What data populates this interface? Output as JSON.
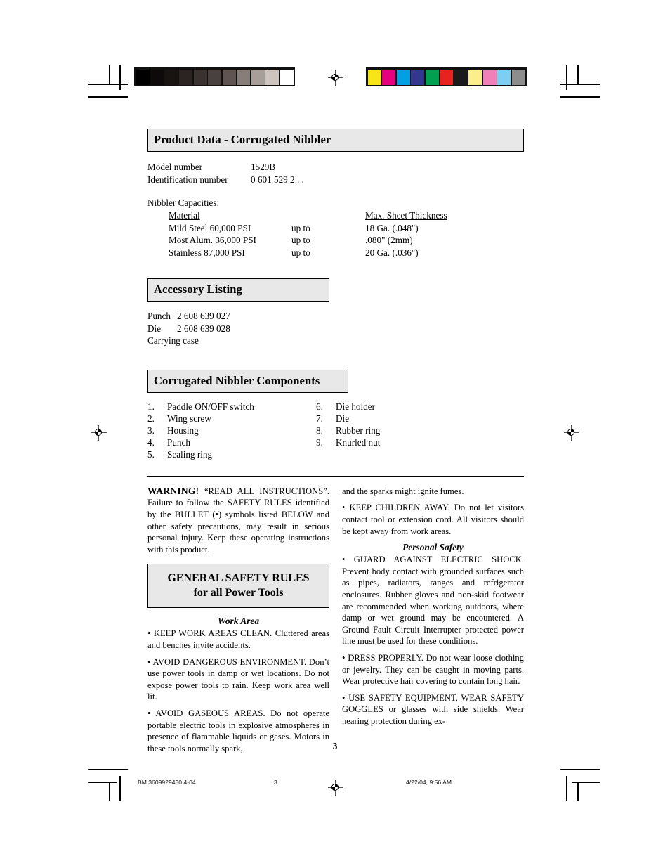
{
  "document": {
    "page_number": "3"
  },
  "print_marks": {
    "grayscale_swatches": [
      "#000000",
      "#0d0a09",
      "#191412",
      "#2b2422",
      "#3a322f",
      "#4a403d",
      "#5f5450",
      "#887e79",
      "#a89e99",
      "#cdc4bf",
      "#ffffff"
    ],
    "color_swatches": [
      "#f7e617",
      "#e5007d",
      "#00a0e3",
      "#33378f",
      "#00a050",
      "#e8221e",
      "#1a1a1a",
      "#faef8a",
      "#f280b8",
      "#7ecef4",
      "#8d8d8d"
    ],
    "registration_icon": "registration-target-icon"
  },
  "product_data": {
    "heading": "Product Data -  Corrugated Nibbler",
    "specs": [
      {
        "label": "Model number",
        "value": "1529B"
      },
      {
        "label": "Identification number",
        "value": "0 601 529 2 . ."
      }
    ],
    "capacities_title": "Nibbler Capacities:",
    "capacities_headers": {
      "material": "Material",
      "upto": "",
      "thickness": "Max. Sheet Thickness"
    },
    "capacities_rows": [
      {
        "material": "Mild Steel 60,000 PSI",
        "upto": "up to",
        "thickness": "18 Ga. (.048\")"
      },
      {
        "material": "Most Alum. 36,000 PSI",
        "upto": "up to",
        "thickness": ".080\" (2mm)"
      },
      {
        "material": "Stainless 87,000 PSI",
        "upto": "up to",
        "thickness": "20 Ga. (.036\")"
      }
    ]
  },
  "accessory_listing": {
    "heading": "Accessory Listing",
    "rows": [
      {
        "name": "Punch",
        "number": "2 608 639 027"
      },
      {
        "name": "Die",
        "number": "2 608 639 028"
      },
      {
        "name": "Carrying case",
        "number": ""
      }
    ]
  },
  "components": {
    "heading": "Corrugated Nibbler Components",
    "left": [
      {
        "num": "1.",
        "label": "Paddle ON/OFF switch"
      },
      {
        "num": "2.",
        "label": "Wing screw"
      },
      {
        "num": "3.",
        "label": "Housing"
      },
      {
        "num": "4.",
        "label": "Punch"
      },
      {
        "num": "5.",
        "label": "Sealing ring"
      }
    ],
    "right": [
      {
        "num": "6.",
        "label": "Die holder"
      },
      {
        "num": "7.",
        "label": "Die"
      },
      {
        "num": "8.",
        "label": "Rubber ring"
      },
      {
        "num": "9.",
        "label": "Knurled nut"
      }
    ]
  },
  "warning": {
    "word": "WARNING!",
    "text": "  “READ ALL INSTRUCTIONS”. Failure to follow the SAFETY RULES identified by the BULLET (•) symbols listed BELOW and other safety precautions, may result in serious personal injury.  Keep these operating instructions with this product."
  },
  "general_safety_box": {
    "line1": "GENERAL SAFETY RULES",
    "line2": "for all Power Tools"
  },
  "work_area": {
    "subhead": "Work Area",
    "items": [
      "•  KEEP WORK AREAS CLEAN.  Cluttered areas and benches invite accidents.",
      "•  AVOID DANGEROUS ENVIRONMENT. Don’t use power tools in damp or wet locations. Do not expose power tools to rain.  Keep work area well lit.",
      "•  AVOID GASEOUS AREAS.  Do not operate portable electric tools in explosive atmospheres in presence of flammable liquids or gases. Motors in these tools normally spark,"
    ]
  },
  "right_column": {
    "continuation": "and the sparks might ignite fumes.",
    "children_item": "•  KEEP CHILDREN AWAY.  Do not let visitors contact tool or extension cord.  All visitors should be kept away from work areas.",
    "personal_safety_subhead": "Personal Safety",
    "items": [
      "• GUARD AGAINST ELECTRIC SHOCK. Prevent body contact with grounded surfaces such as pipes, radiators, ranges and refrigerator enclosures. Rubber gloves and non-skid footwear are recommended when working outdoors, where damp or wet ground may be encountered. A Ground Fault Circuit Interrupter protected power line must be used for these conditions.",
      "•  DRESS PROPERLY.  Do not wear loose clothing or jewelry. They can be caught in moving parts. Wear protective hair covering to contain long hair.",
      "• USE SAFETY EQUIPMENT. WEAR SAFETY GOGGLES or glasses with side shields. Wear hearing protection during ex-"
    ]
  },
  "footer": {
    "left": "BM 3609929430 4-04",
    "center": "3",
    "right": "4/22/04, 9:56 AM"
  }
}
